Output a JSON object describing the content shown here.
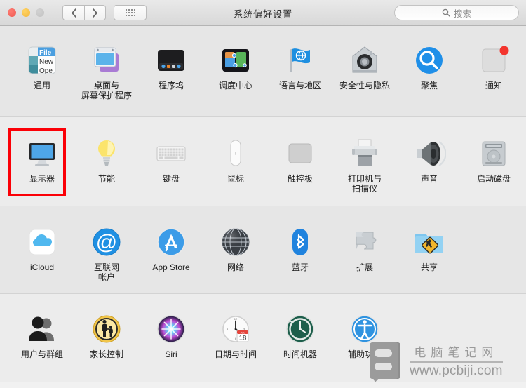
{
  "window": {
    "title": "系统偏好设置",
    "traffic_lights": [
      "close",
      "minimize",
      "zoom"
    ],
    "nav": {
      "back_label": "‹",
      "forward_label": "›"
    },
    "grid_button_name": "show-all-grid",
    "search": {
      "placeholder": "搜索",
      "value": "",
      "icon": "search-icon"
    }
  },
  "selection": {
    "highlighted_item": "显示器",
    "color": "#fb0007"
  },
  "rows": [
    {
      "shade": true,
      "items": [
        {
          "label": "通用",
          "icon": "general-icon"
        },
        {
          "label": "桌面与\n屏幕保护程序",
          "icon": "desktop-screensaver-icon"
        },
        {
          "label": "程序坞",
          "icon": "dock-icon"
        },
        {
          "label": "调度中心",
          "icon": "mission-control-icon"
        },
        {
          "label": "语言与地区",
          "icon": "language-region-icon"
        },
        {
          "label": "安全性与隐私",
          "icon": "security-privacy-icon"
        },
        {
          "label": "聚焦",
          "icon": "spotlight-icon"
        },
        {
          "label": "通知",
          "icon": "notifications-icon"
        }
      ]
    },
    {
      "shade": false,
      "items": [
        {
          "label": "显示器",
          "icon": "displays-icon"
        },
        {
          "label": "节能",
          "icon": "energy-saver-icon"
        },
        {
          "label": "键盘",
          "icon": "keyboard-icon"
        },
        {
          "label": "鼠标",
          "icon": "mouse-icon"
        },
        {
          "label": "触控板",
          "icon": "trackpad-icon"
        },
        {
          "label": "打印机与\n扫描仪",
          "icon": "printers-scanners-icon"
        },
        {
          "label": "声音",
          "icon": "sound-icon"
        },
        {
          "label": "启动磁盘",
          "icon": "startup-disk-icon"
        }
      ]
    },
    {
      "shade": true,
      "items": [
        {
          "label": "iCloud",
          "icon": "icloud-icon"
        },
        {
          "label": "互联网\n帐户",
          "icon": "internet-accounts-icon"
        },
        {
          "label": "App Store",
          "icon": "app-store-icon"
        },
        {
          "label": "网络",
          "icon": "network-icon"
        },
        {
          "label": "蓝牙",
          "icon": "bluetooth-icon"
        },
        {
          "label": "扩展",
          "icon": "extensions-icon"
        },
        {
          "label": "共享",
          "icon": "sharing-icon"
        }
      ]
    },
    {
      "shade": false,
      "items": [
        {
          "label": "用户与群组",
          "icon": "users-groups-icon"
        },
        {
          "label": "家长控制",
          "icon": "parental-controls-icon"
        },
        {
          "label": "Siri",
          "icon": "siri-icon"
        },
        {
          "label": "日期与时间",
          "icon": "date-time-icon"
        },
        {
          "label": "时间机器",
          "icon": "time-machine-icon"
        },
        {
          "label": "辅助功能",
          "icon": "accessibility-icon"
        }
      ]
    }
  ],
  "watermark": {
    "site_name": "电脑笔记网",
    "url": "www.pcbiji.com"
  },
  "icon_details": {
    "date_time_day": "18",
    "date_time_month": "JUL",
    "dock_label": "dock",
    "general_tiles": [
      "File",
      "New",
      "Ope"
    ]
  }
}
